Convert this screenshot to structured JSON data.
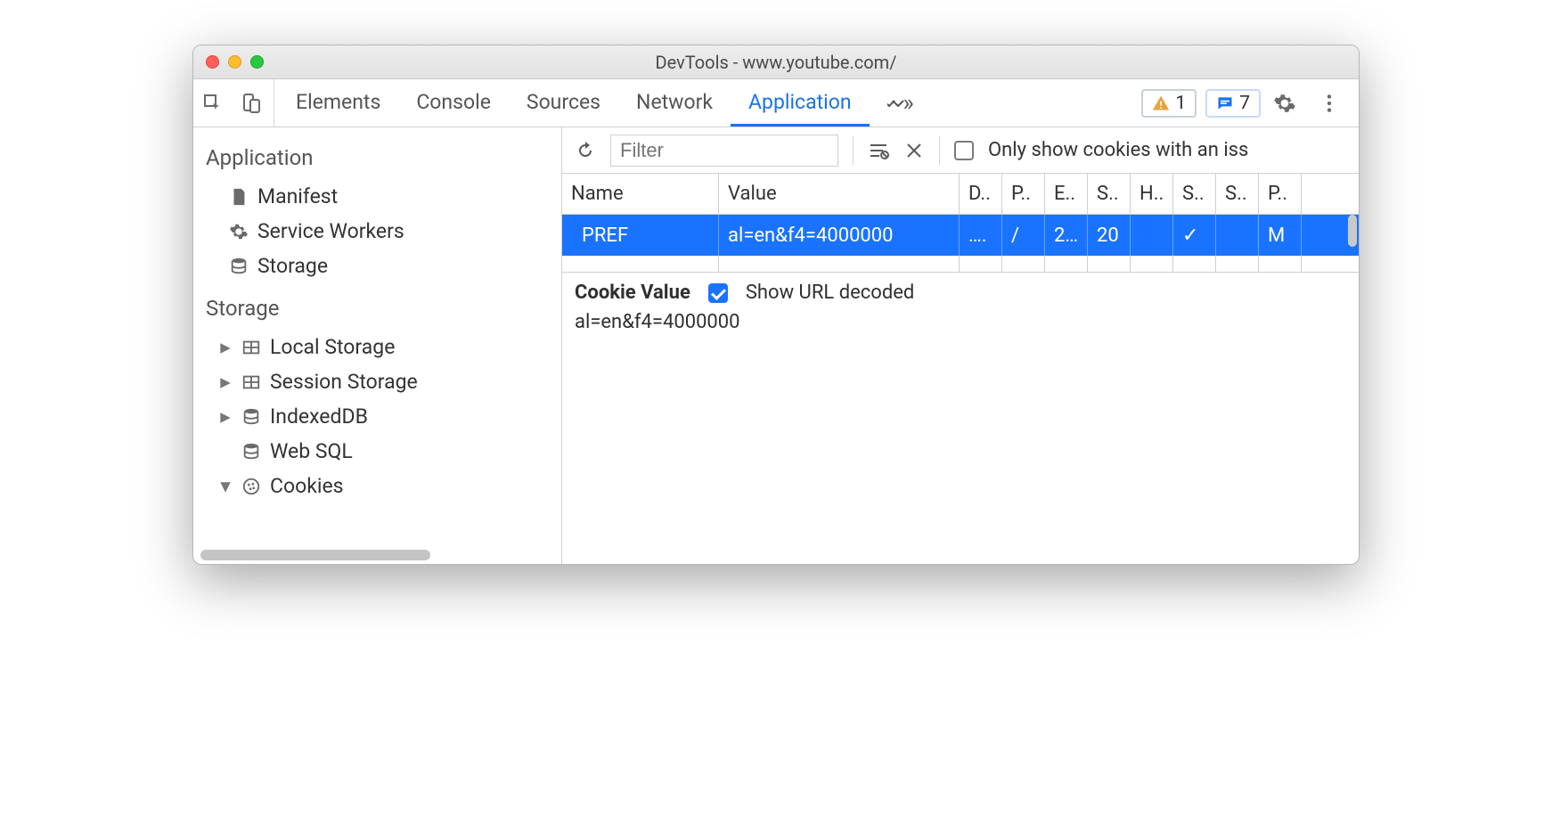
{
  "window": {
    "title": "DevTools - www.youtube.com/"
  },
  "toolbar": {
    "tabs": [
      "Elements",
      "Console",
      "Sources",
      "Network",
      "Application"
    ],
    "active_tab": "Application",
    "warnings_count": "1",
    "messages_count": "7"
  },
  "sidebar": {
    "sections": [
      {
        "title": "Application",
        "items": [
          {
            "icon": "file-icon",
            "label": "Manifest"
          },
          {
            "icon": "gear-icon",
            "label": "Service Workers"
          },
          {
            "icon": "db-icon",
            "label": "Storage"
          }
        ]
      },
      {
        "title": "Storage",
        "items": [
          {
            "caret": "▸",
            "icon": "grid-icon",
            "label": "Local Storage"
          },
          {
            "caret": "▸",
            "icon": "grid-icon",
            "label": "Session Storage"
          },
          {
            "caret": "▸",
            "icon": "db-icon",
            "label": "IndexedDB"
          },
          {
            "caret": "",
            "icon": "db-icon",
            "label": "Web SQL"
          },
          {
            "caret": "▾",
            "icon": "cookie-icon",
            "label": "Cookies"
          }
        ]
      }
    ]
  },
  "main": {
    "filter_placeholder": "Filter",
    "only_issue_label": "Only show cookies with an iss",
    "columns": [
      "Name",
      "Value",
      "D..",
      "P..",
      "E..",
      "S..",
      "H..",
      "S..",
      "S..",
      "P.."
    ],
    "rows": [
      {
        "cells": [
          "PREF",
          "al=en&f4=4000000",
          "….",
          "/",
          "2…",
          "20",
          "",
          "✓",
          "",
          "M"
        ]
      }
    ],
    "detail": {
      "title": "Cookie Value",
      "decode_label": "Show URL decoded",
      "decoded_value": "al=en&f4=4000000"
    }
  }
}
